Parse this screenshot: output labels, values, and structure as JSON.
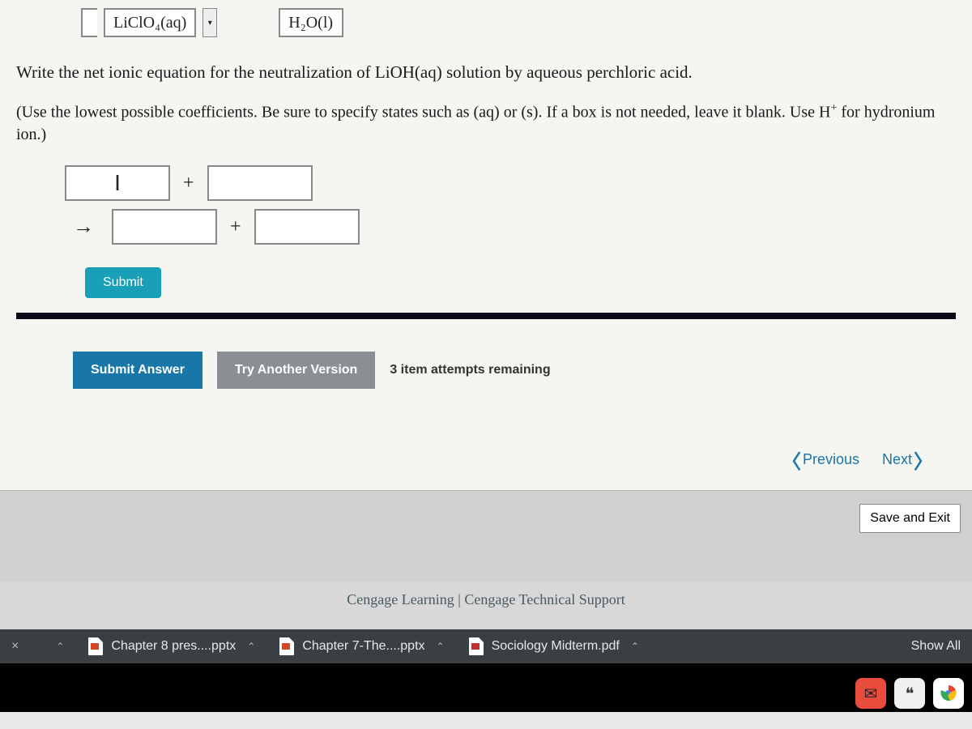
{
  "given": {
    "reactant": "LiClO₄(aq)",
    "product": "H₂O(l)"
  },
  "question": "Write the net ionic equation for the neutralization of LiOH(aq) solution by aqueous perchloric acid.",
  "instruction_prefix": "(Use the lowest possible coefficients. Be sure to specify states such as (aq) or (s). If a box is not needed, leave it blank. Use H",
  "instruction_sup": "+",
  "instruction_suffix": " for hydronium ion.)",
  "cursor_glyph": "I",
  "plus": "+",
  "arrow": "→",
  "buttons": {
    "submit": "Submit",
    "submit_answer": "Submit Answer",
    "try_another": "Try Another Version",
    "save_exit": "Save and Exit"
  },
  "attempts": "3 item attempts remaining",
  "nav": {
    "previous": "Previous",
    "next": "Next"
  },
  "footer": {
    "cengage": "Cengage Learning",
    "sep": " | ",
    "support": "Cengage Technical Support"
  },
  "downloads": {
    "items": [
      {
        "name": "Chapter 8 pres....pptx",
        "type": "ppt"
      },
      {
        "name": "Chapter 7-The....pptx",
        "type": "ppt"
      },
      {
        "name": "Sociology Midterm.pdf",
        "type": "pdf"
      }
    ],
    "show_all": "Show All",
    "close": "×",
    "caret": "⌃"
  }
}
